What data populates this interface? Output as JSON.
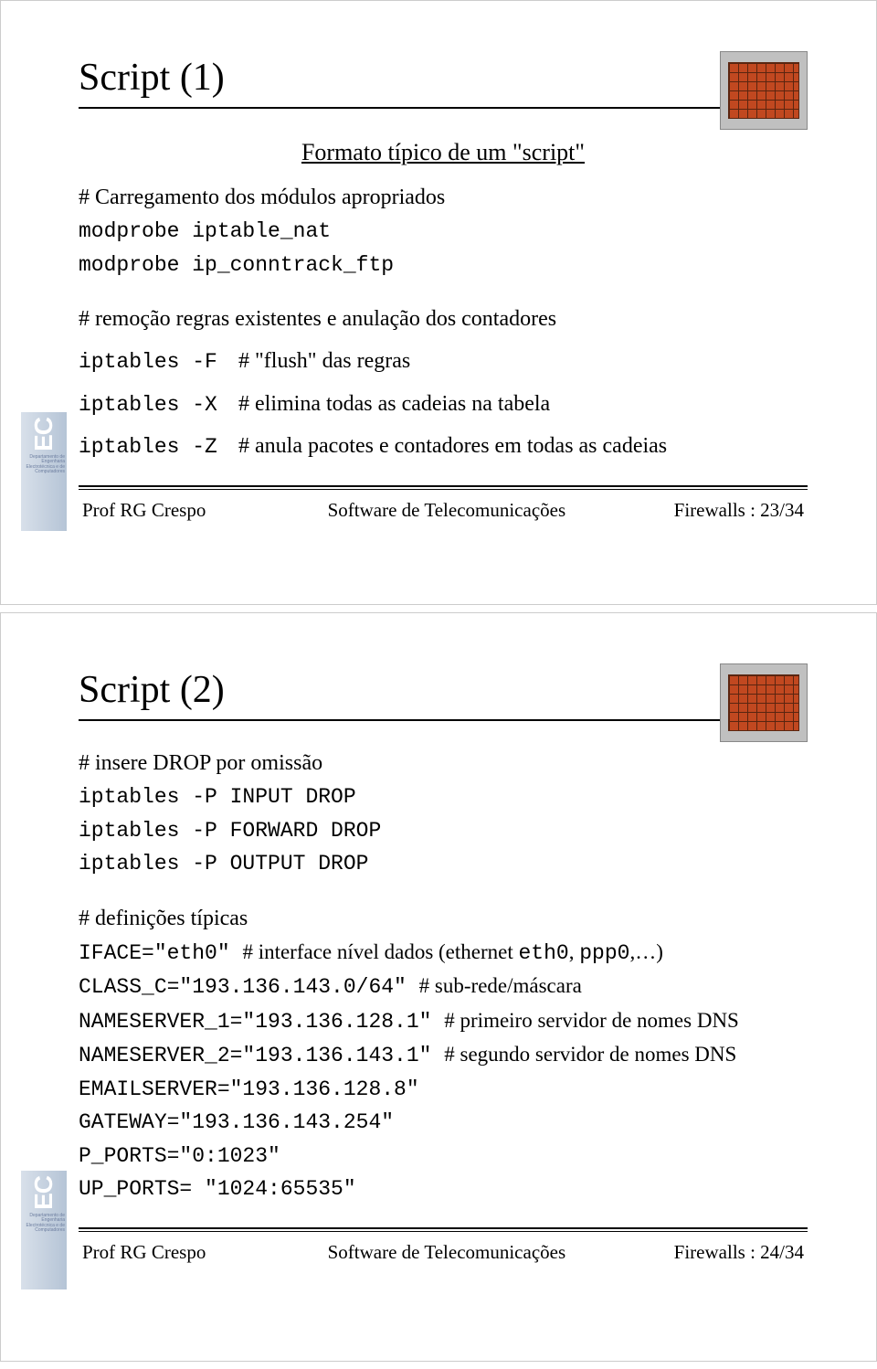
{
  "slide1": {
    "title": "Script (1)",
    "subtitle": "Formato típico de um \"script\"",
    "c_load": "# Carregamento dos módulos apropriados",
    "code1": "modprobe iptable_nat",
    "code2": "modprobe ip_conntrack_ftp",
    "c_rem": "# remoção regras existentes e anulação dos contadores",
    "rows": [
      {
        "code": "iptables -F",
        "comment": "# \"flush\" das regras"
      },
      {
        "code": "iptables -X",
        "comment": "# elimina todas as cadeias na tabela"
      },
      {
        "code": "iptables -Z",
        "comment": "# anula pacotes e contadores em todas as cadeias"
      }
    ],
    "footer": {
      "left": "Prof RG Crespo",
      "center": "Software de Telecomunicações",
      "right": "Firewalls : 23/34"
    }
  },
  "slide2": {
    "title": "Script (2)",
    "c_drop": "# insere DROP por omissão",
    "drop1": "iptables -P INPUT DROP",
    "drop2": "iptables -P FORWARD DROP",
    "drop3": "iptables -P OUTPUT DROP",
    "c_def": "# definições típicas",
    "iface_code": "IFACE=\"eth0\" ",
    "iface_comment_a": "# interface nível dados (ethernet ",
    "iface_comment_b": "eth0",
    "iface_comment_c": ", ",
    "iface_comment_d": "ppp0",
    "iface_comment_e": ",…)",
    "classc_code": "CLASS_C=\"193.136.143.0/64\" ",
    "classc_comment": "# sub-rede/máscara",
    "ns1_code": "NAMESERVER_1=\"193.136.128.1\" ",
    "ns1_comment": "# primeiro servidor de nomes DNS",
    "ns2_code": "NAMESERVER_2=\"193.136.143.1\" ",
    "ns2_comment": "# segundo servidor de nomes DNS",
    "email": "EMAILSERVER=\"193.136.128.8\"",
    "gw": "GATEWAY=\"193.136.143.254\"",
    "pports": "P_PORTS=\"0:1023\"",
    "upports": "UP_PORTS= \"1024:65535\"",
    "footer": {
      "left": "Prof RG Crespo",
      "center": "Software de Telecomunicações",
      "right": "Firewalls : 24/34"
    }
  },
  "logo": {
    "ec": "EC",
    "dept": "Departamento de Engenharia Electrotécnica e de Computadores"
  }
}
